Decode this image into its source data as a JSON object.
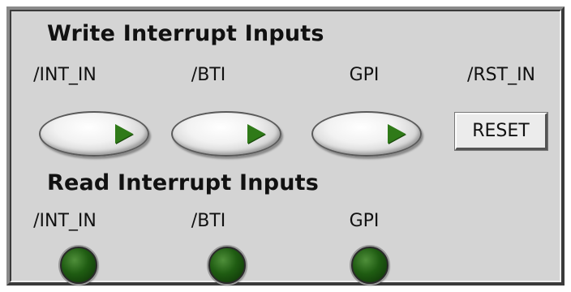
{
  "write_section": {
    "title": "Write Interrupt Inputs",
    "labels": [
      "/INT_IN",
      "/BTI",
      "GPI",
      "/RST_IN"
    ],
    "reset_label": "RESET"
  },
  "read_section": {
    "title": "Read Interrupt Inputs",
    "labels": [
      "/INT_IN",
      "/BTI",
      "GPI"
    ]
  },
  "colors": {
    "panel": "#d4d4d4",
    "led_off": "#1f5c12",
    "switch_arrow": "#2f7a18"
  }
}
